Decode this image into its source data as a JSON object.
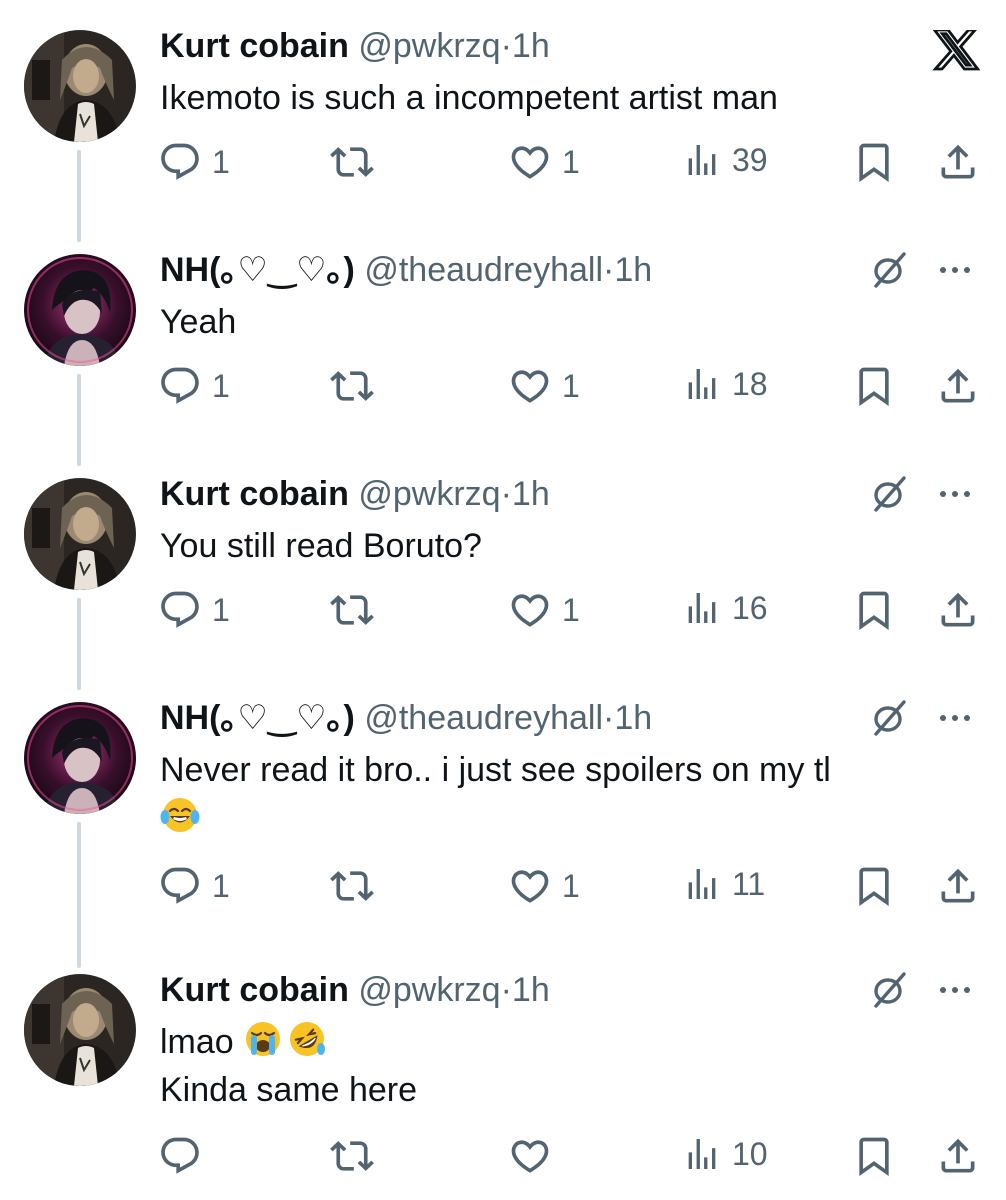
{
  "tweets": [
    {
      "author": "Kurt cobain",
      "handle": "@pwkrzq",
      "dot": "·",
      "time": "1h",
      "lines": [
        "Ikemoto is such a incompetent artist man"
      ],
      "replies": "1",
      "retweets": "",
      "likes": "1",
      "views": "39"
    },
    {
      "author": "NH(｡♡‿♡｡)",
      "handle": "@theaudreyhall",
      "dot": "·",
      "time": "1h",
      "lines": [
        "Yeah"
      ],
      "replies": "1",
      "retweets": "",
      "likes": "1",
      "views": "18"
    },
    {
      "author": "Kurt cobain",
      "handle": "@pwkrzq",
      "dot": "·",
      "time": "1h",
      "lines": [
        "You still read Boruto?"
      ],
      "replies": "1",
      "retweets": "",
      "likes": "1",
      "views": "16"
    },
    {
      "author": "NH(｡♡‿♡｡)",
      "handle": "@theaudreyhall",
      "dot": "·",
      "time": "1h",
      "lines": [
        "Never read it bro.. i just see spoilers on my tl"
      ],
      "emoji_line": [
        "face-with-tears-of-joy"
      ],
      "replies": "1",
      "retweets": "",
      "likes": "1",
      "views": "11"
    },
    {
      "author": "Kurt cobain",
      "handle": "@pwkrzq",
      "dot": "·",
      "time": "1h",
      "lines": [
        "lmao",
        "Kinda same here"
      ],
      "inline_emojis": [
        "loudly-crying-face",
        "rolling-on-the-floor-laughing"
      ],
      "replies": "",
      "retweets": "",
      "likes": "",
      "views": "10"
    }
  ],
  "icons": {
    "app_logo": "x-logo-icon",
    "grok": "grok-slash-icon",
    "more": "more-dots-icon",
    "reply": "reply-icon",
    "retweet": "retweet-icon",
    "like": "heart-icon",
    "views": "views-bar-chart-icon",
    "bookmark": "bookmark-icon",
    "share": "share-icon"
  },
  "colors": {
    "text": "#0f1419",
    "secondary": "#536471",
    "thread_line": "#cfd9de"
  }
}
